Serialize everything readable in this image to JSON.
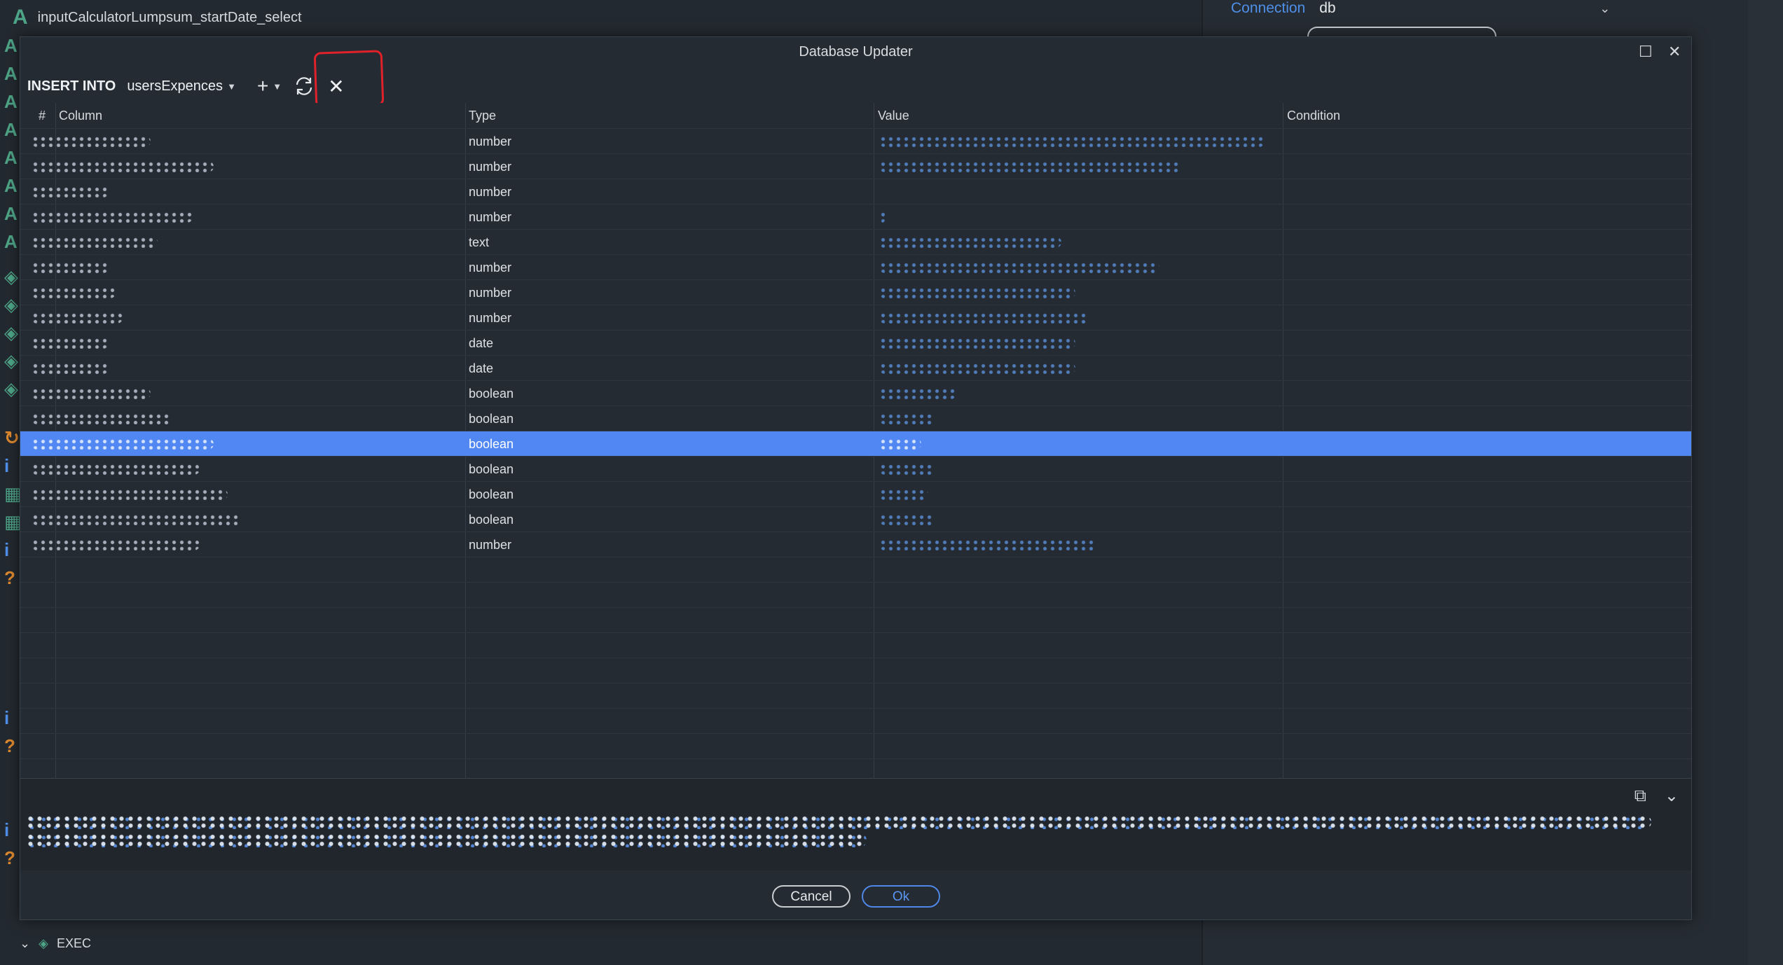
{
  "ide": {
    "breadcrumb": "inputCalculatorLumpsum_startDate_select",
    "connection_label": "Connection",
    "connection_value": "db",
    "bottom_node_label": "EXEC"
  },
  "dialog": {
    "title": "Database Updater",
    "toolbar": {
      "insert_into": "INSERT INTO",
      "table_name": "usersExpences"
    },
    "columns": [
      "#",
      "Column",
      "Type",
      "Value",
      "Condition"
    ],
    "rows": [
      {
        "type": "number"
      },
      {
        "type": "number"
      },
      {
        "type": "number"
      },
      {
        "type": "number"
      },
      {
        "type": "text"
      },
      {
        "type": "number"
      },
      {
        "type": "number"
      },
      {
        "type": "number"
      },
      {
        "type": "date"
      },
      {
        "type": "date"
      },
      {
        "type": "boolean"
      },
      {
        "type": "boolean"
      },
      {
        "type": "boolean",
        "selected": true
      },
      {
        "type": "boolean"
      },
      {
        "type": "boolean"
      },
      {
        "type": "boolean"
      },
      {
        "type": "number"
      }
    ],
    "buttons": {
      "cancel": "Cancel",
      "ok": "Ok"
    }
  },
  "colors": {
    "selection": "#5087f2",
    "annotation": "#e0212a",
    "accent": "#4e8fe8"
  }
}
